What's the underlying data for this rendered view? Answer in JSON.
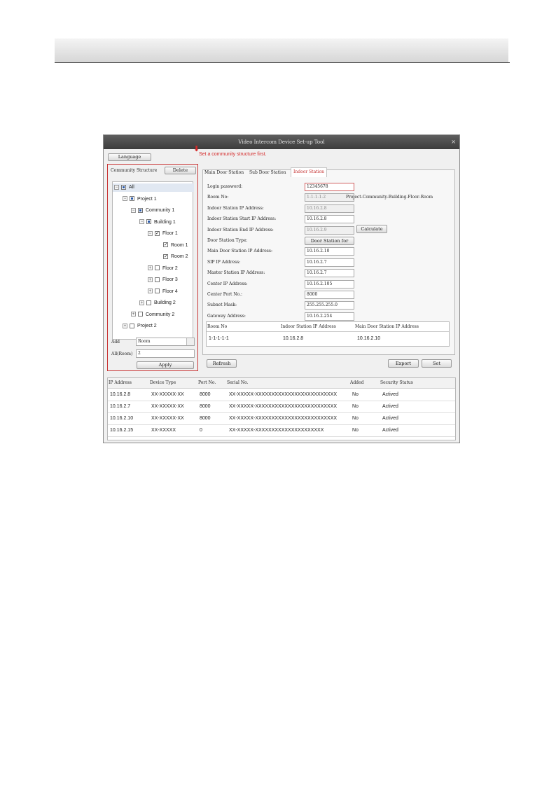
{
  "window": {
    "title": "Video Intercom Device Set-up Tool",
    "close_glyph": "×"
  },
  "toolbar": {
    "language_label": "Language"
  },
  "annotation": {
    "text": "Set a community structure first.",
    "arrow_glyph": "⬇"
  },
  "community": {
    "title": "Community Structure",
    "delete_label": "Delete",
    "tree": [
      {
        "label": "All",
        "toggle": "−",
        "check": "partial"
      },
      {
        "label": "Project 1",
        "toggle": "−",
        "check": "partial"
      },
      {
        "label": "Community 1",
        "toggle": "−",
        "check": "partial"
      },
      {
        "label": "Building 1",
        "toggle": "−",
        "check": "partial"
      },
      {
        "label": "Floor 1",
        "toggle": "−",
        "check": "checked"
      },
      {
        "label": "Room 1",
        "toggle": "",
        "check": "checked"
      },
      {
        "label": "Room 2",
        "toggle": "",
        "check": "checked"
      },
      {
        "label": "Floor 2",
        "toggle": "+",
        "check": "none"
      },
      {
        "label": "Floor 3",
        "toggle": "+",
        "check": "none"
      },
      {
        "label": "Floor 4",
        "toggle": "+",
        "check": "none"
      },
      {
        "label": "Building 2",
        "toggle": "+",
        "check": "none"
      },
      {
        "label": "Community 2",
        "toggle": "+",
        "check": "none"
      },
      {
        "label": "Project 2",
        "toggle": "+",
        "check": "none"
      }
    ],
    "add_label": "Add",
    "add_select": "Room",
    "all_room_label": "All(Room)",
    "all_room_value": "2",
    "apply_label": "Apply"
  },
  "tabs": [
    "Main Door Station",
    "Sub Door Station",
    "Indoor Station"
  ],
  "form": {
    "fields": [
      {
        "label": "Login password:",
        "value": "12345678"
      },
      {
        "label": "Room No:",
        "value": "1-1-1-1-2"
      },
      {
        "label": "Indoor Station IP Address:",
        "value": "10.16.2.8"
      },
      {
        "label": "Indoor Station Start IP Address:",
        "value": "10.16.2.8"
      },
      {
        "label": "Indoor Station End IP Address:",
        "value": "10.16.2.9"
      },
      {
        "label": "Door Station Type:",
        "value": "Door Station for"
      },
      {
        "label": "Main Door Station IP Address:",
        "value": "10.16.2.10"
      },
      {
        "label": "SIP IP Address:",
        "value": "10.16.2.7"
      },
      {
        "label": "Master Station IP Address:",
        "value": "10.16.2.7"
      },
      {
        "label": "Center IP Address:",
        "value": "10.16.2.105"
      },
      {
        "label": "Center Port No.:",
        "value": "8000"
      },
      {
        "label": "Subnet Mask:",
        "value": "255.255.255.0"
      },
      {
        "label": "Gateway Address:",
        "value": "10.16.2.254"
      }
    ],
    "room_hint": "Project-Community-Building-Floor-Room",
    "calculate_label": "Calculate"
  },
  "room_table": {
    "headers": [
      "Room No",
      "Indoor Station IP Address",
      "Main Door Station IP Address"
    ],
    "row": [
      "1-1-1-1-1",
      "10.16.2.8",
      "10.16.2.10"
    ]
  },
  "actions": {
    "refresh": "Refresh",
    "export": "Export",
    "set": "Set"
  },
  "device_table": {
    "headers": [
      "IP Address",
      "Device Type",
      "Port No.",
      "Serial No.",
      "Added",
      "Security Status"
    ],
    "rows": [
      [
        "10.16.2.8",
        "XX-XXXXX-XX",
        "8000",
        "XX-XXXXX-XXXXXXXXXXXXXXXXXXXXXXXXX",
        "No",
        "Actived"
      ],
      [
        "10.16.2.7",
        "XX-XXXXX-XX",
        "8000",
        "XX-XXXXX-XXXXXXXXXXXXXXXXXXXXXXXXX",
        "No",
        "Actived"
      ],
      [
        "10.16.2.10",
        "XX-XXXXX-XX",
        "8000",
        "XX-XXXXX-XXXXXXXXXXXXXXXXXXXXXXXXX",
        "No",
        "Actived"
      ],
      [
        "10.16.2.15",
        "XX-XXXXX",
        "0",
        "XX-XXXXX-XXXXXXXXXXXXXXXXXXXXX",
        "No",
        "Actived"
      ]
    ]
  }
}
